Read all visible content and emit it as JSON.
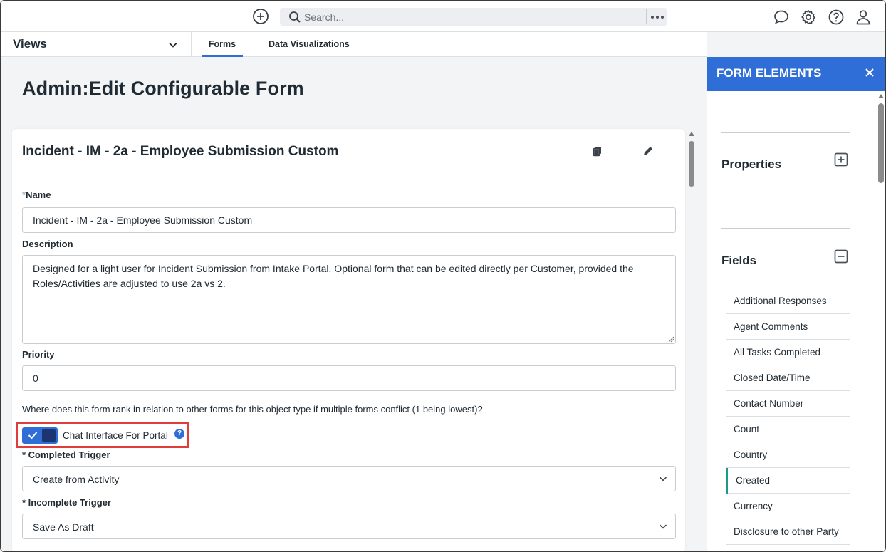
{
  "topbar": {
    "search_placeholder": "Search...",
    "icons": [
      "add-circle-icon",
      "search-icon",
      "more-icon",
      "chat-icon",
      "gear-icon",
      "help-icon",
      "user-icon"
    ]
  },
  "views": {
    "label": "Views",
    "tabs": [
      {
        "label": "Forms",
        "active": true
      },
      {
        "label": "Data Visualizations",
        "active": false
      }
    ]
  },
  "page": {
    "title_prefix": "Admin",
    "title_separator": ":",
    "title_main": "Edit Configurable Form"
  },
  "form": {
    "card_title": "Incident - IM - 2a - Employee Submission Custom",
    "name_label": "Name",
    "name_required_mark": "*",
    "name_value": "Incident - IM - 2a - Employee Submission Custom",
    "description_label": "Description",
    "description_value": "Designed for a light user for Incident Submission from Intake Portal. Optional form that can be edited directly per Customer, provided the Roles/Activities are adjusted to use 2a vs 2.",
    "priority_label": "Priority",
    "priority_value": "0",
    "priority_help": "Where does this form rank in relation to other forms for this object type if multiple forms conflict (1 being lowest)?",
    "chat_toggle_label": "Chat Interface For Portal",
    "chat_toggle_on": true,
    "info_glyph": "?",
    "completed_trigger_label": "* Completed Trigger",
    "completed_trigger_value": "Create from Activity",
    "incomplete_trigger_label": "* Incomplete Trigger",
    "incomplete_trigger_value": "Save As Draft"
  },
  "panel": {
    "title": "FORM ELEMENTS",
    "properties_label": "Properties",
    "fields_label": "Fields",
    "fields": [
      "Additional Responses",
      "Agent Comments",
      "All Tasks Completed",
      "Closed Date/Time",
      "Contact Number",
      "Count",
      "Country",
      "Created",
      "Currency",
      "Disclosure to other Party"
    ],
    "selected_field": "Created"
  },
  "colors": {
    "accent": "#2f6ed6",
    "highlight": "#e03c3c",
    "selected_marker": "#1a9a8a"
  }
}
